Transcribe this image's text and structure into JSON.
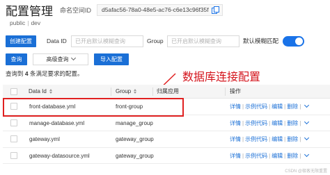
{
  "header": {
    "title": "配置管理",
    "namespace_label": "命名空间ID",
    "namespace_id": "d5afac56-78a0-48e5-ac76-c6e13c96f35f"
  },
  "breadcrumb": [
    "public",
    "dev"
  ],
  "filters": {
    "create_button": "创建配置",
    "data_id_label": "Data ID",
    "data_id_placeholder": "已开启默认模糊查询",
    "group_label": "Group",
    "group_placeholder": "已开启默认模糊查询",
    "fuzzy_label": "默认模糊匹配",
    "fuzzy_enabled": true
  },
  "actions": {
    "query_button": "查询",
    "advanced_query": "高级查询",
    "import_button": "导入配置"
  },
  "result": {
    "prefix": "查询到",
    "count": "4",
    "suffix": "条满足要求的配置。"
  },
  "table": {
    "columns": [
      "Data Id",
      "Group",
      "归属应用",
      "操作"
    ],
    "rows": [
      {
        "data_id": "front-database.yml",
        "group": "front-group",
        "app": ""
      },
      {
        "data_id": "manage-database.yml",
        "group": "manage_group",
        "app": ""
      },
      {
        "data_id": "gateway.yml",
        "group": "gateway_group",
        "app": ""
      },
      {
        "data_id": "gateway-datasource.yml",
        "group": "gateway_group",
        "app": ""
      }
    ],
    "operations": [
      "详情",
      "示例代码",
      "编辑",
      "删除"
    ],
    "more_icon": "chevron-down-icon"
  },
  "annotation": {
    "callout": "数据库连接配置",
    "color": "#d4141c"
  },
  "watermark": "CSDN @极客无限重置",
  "colors": {
    "primary": "#1a6fd6",
    "accent_red": "#e02020"
  }
}
